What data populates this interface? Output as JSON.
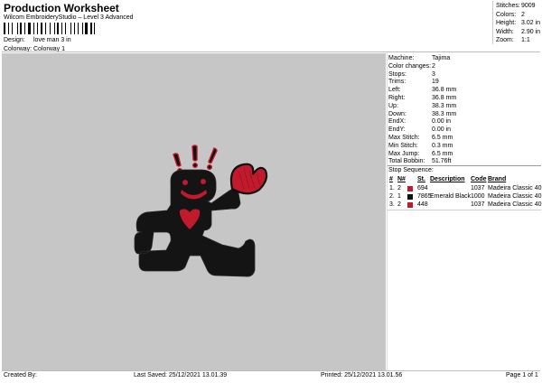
{
  "header": {
    "title": "Production Worksheet",
    "subtitle": "Wilcom EmbroideryStudio – Level 3 Advanced",
    "design_label": "Design:",
    "design_value": "love man 3 in",
    "colorway_label": "Colorway:",
    "colorway_value": "Colorway 1"
  },
  "summary": [
    {
      "label": "Stitches:",
      "value": "9009"
    },
    {
      "label": "Colors:",
      "value": "2"
    },
    {
      "label": "Height:",
      "value": "3.02 in"
    },
    {
      "label": "Width:",
      "value": "2.90 in"
    },
    {
      "label": "Zoom:",
      "value": "1:1"
    }
  ],
  "details": [
    {
      "label": "Machine:",
      "value": "Tajima"
    },
    {
      "label": "Color changes:",
      "value": "2"
    },
    {
      "label": "Stops:",
      "value": "3"
    },
    {
      "label": "Trims:",
      "value": "19"
    },
    {
      "label": "Left:",
      "value": "36.8 mm"
    },
    {
      "label": "Right:",
      "value": "36.8 mm"
    },
    {
      "label": "Up:",
      "value": "38.3 mm"
    },
    {
      "label": "Down:",
      "value": "38.3 mm"
    },
    {
      "label": "EndX:",
      "value": "0.00 in"
    },
    {
      "label": "EndY:",
      "value": "0.00 in"
    },
    {
      "label": "Max Stitch:",
      "value": "6.5 mm"
    },
    {
      "label": "Min Stitch:",
      "value": "0.3 mm"
    },
    {
      "label": "Max Jump:",
      "value": "6.5 mm"
    },
    {
      "label": "Total Bobbin:",
      "value": "51.76ft"
    }
  ],
  "stop_sequence": {
    "title": "Stop Sequence:",
    "headers": {
      "num": "#",
      "n": "N#",
      "st": "St.",
      "description": "Description",
      "code": "Code",
      "brand": "Brand"
    },
    "rows": [
      {
        "num": "1.",
        "n": "2",
        "color": "#c01a2c",
        "st": "694",
        "description": "",
        "code": "1037",
        "brand": "Madeira Classic 40"
      },
      {
        "num": "2.",
        "n": "1",
        "color": "#111111",
        "st": "7865",
        "description": "Emerald Black",
        "code": "1000",
        "brand": "Madeira Classic 40"
      },
      {
        "num": "3.",
        "n": "2",
        "color": "#c01a2c",
        "st": "448",
        "description": "",
        "code": "1037",
        "brand": "Madeira Classic 40"
      }
    ]
  },
  "footer": {
    "created_by": "Created By:",
    "last_saved": "Last Saved: 25/12/2021 13.01.39",
    "printed": "Printed: 25/12/2021 13.01.56",
    "page": "Page 1 of 1"
  },
  "colors": {
    "canvas_bg": "#c6c6c6",
    "thread_red": "#c01a2c",
    "thread_black": "#111111"
  }
}
